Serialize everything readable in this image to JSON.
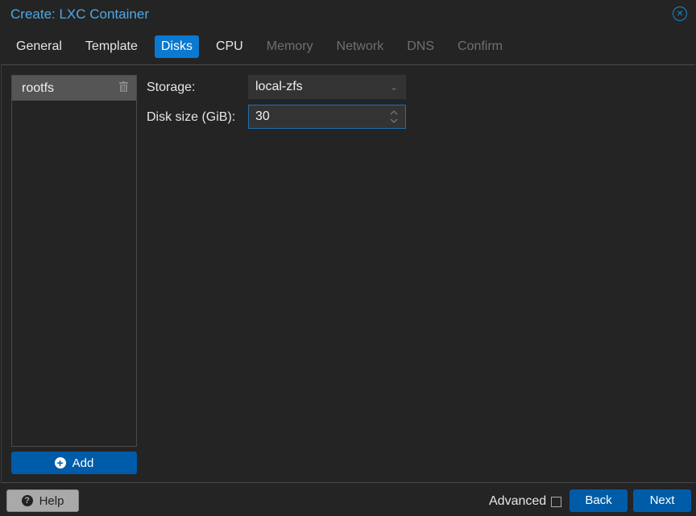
{
  "window": {
    "title": "Create: LXC Container",
    "close_icon": "close-circle-icon"
  },
  "tabs": [
    {
      "label": "General",
      "state": "enabled"
    },
    {
      "label": "Template",
      "state": "enabled"
    },
    {
      "label": "Disks",
      "state": "active"
    },
    {
      "label": "CPU",
      "state": "enabled"
    },
    {
      "label": "Memory",
      "state": "disabled"
    },
    {
      "label": "Network",
      "state": "disabled"
    },
    {
      "label": "DNS",
      "state": "disabled"
    },
    {
      "label": "Confirm",
      "state": "disabled"
    }
  ],
  "disks": {
    "items": [
      {
        "label": "rootfs",
        "icon": "trash-icon"
      }
    ],
    "add_label": "Add"
  },
  "form": {
    "storage_label": "Storage:",
    "storage_value": "local-zfs",
    "disk_size_label": "Disk size (GiB):",
    "disk_size_value": "30"
  },
  "footer": {
    "help_label": "Help",
    "advanced_label": "Advanced",
    "advanced_checked": false,
    "back_label": "Back",
    "next_label": "Next"
  },
  "colors": {
    "accent": "#0a79d1",
    "button": "#005ca8",
    "title": "#4ea9e6"
  }
}
